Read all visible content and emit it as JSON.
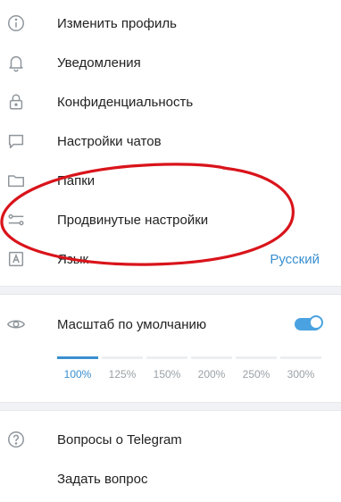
{
  "settings": {
    "items": [
      {
        "label": "Изменить профиль",
        "icon": "info-icon"
      },
      {
        "label": "Уведомления",
        "icon": "bell-icon"
      },
      {
        "label": "Конфиденциальность",
        "icon": "lock-icon"
      },
      {
        "label": "Настройки чатов",
        "icon": "chat-bubble-icon"
      },
      {
        "label": "Папки",
        "icon": "folder-icon"
      },
      {
        "label": "Продвинутые настройки",
        "icon": "sliders-icon"
      },
      {
        "label": "Язык",
        "icon": "language-icon",
        "value": "Русский"
      }
    ]
  },
  "scale": {
    "label": "Масштаб по умолчанию",
    "icon": "eye-icon",
    "enabled": true,
    "options": [
      "100%",
      "125%",
      "150%",
      "200%",
      "250%",
      "300%"
    ],
    "selected": "100%"
  },
  "help": {
    "items": [
      {
        "label": "Вопросы о Telegram",
        "icon": "question-icon"
      },
      {
        "label": "Задать вопрос",
        "icon": ""
      }
    ]
  },
  "colors": {
    "accent": "#3a8fcf",
    "annotation": "#d9141b",
    "icon": "#8e959b"
  }
}
